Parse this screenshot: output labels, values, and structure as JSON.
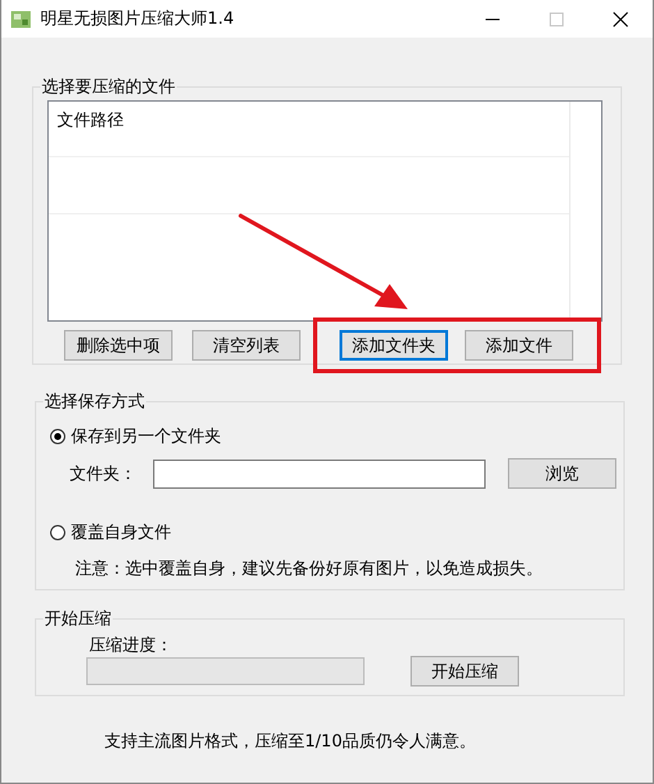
{
  "window": {
    "title": "明星无损图片压缩大师1.4",
    "maximize_disabled": true
  },
  "file_group": {
    "legend": "选择要压缩的文件",
    "list_header": "文件路径",
    "buttons": [
      {
        "label": "删除选中项",
        "focused": false
      },
      {
        "label": "清空列表",
        "focused": false
      },
      {
        "label": "添加文件夹",
        "focused": true
      },
      {
        "label": "添加文件",
        "focused": false
      }
    ]
  },
  "save_group": {
    "legend": "选择保存方式",
    "options": [
      {
        "label": "保存到另一个文件夹",
        "selected": true
      },
      {
        "label": "覆盖自身文件",
        "selected": false
      }
    ],
    "folder_label": "文件夹：",
    "browse_button": "浏览",
    "note": "注意：选中覆盖自身，建议先备份好原有图片，以免造成损失。"
  },
  "compress_group": {
    "legend": "开始压缩",
    "progress_label": "压缩进度：",
    "progress": {
      "level": 0
    },
    "start_button": "开始压缩"
  },
  "footer": "支持主流图片格式，压缩至1/10品质仍令人满意。"
}
